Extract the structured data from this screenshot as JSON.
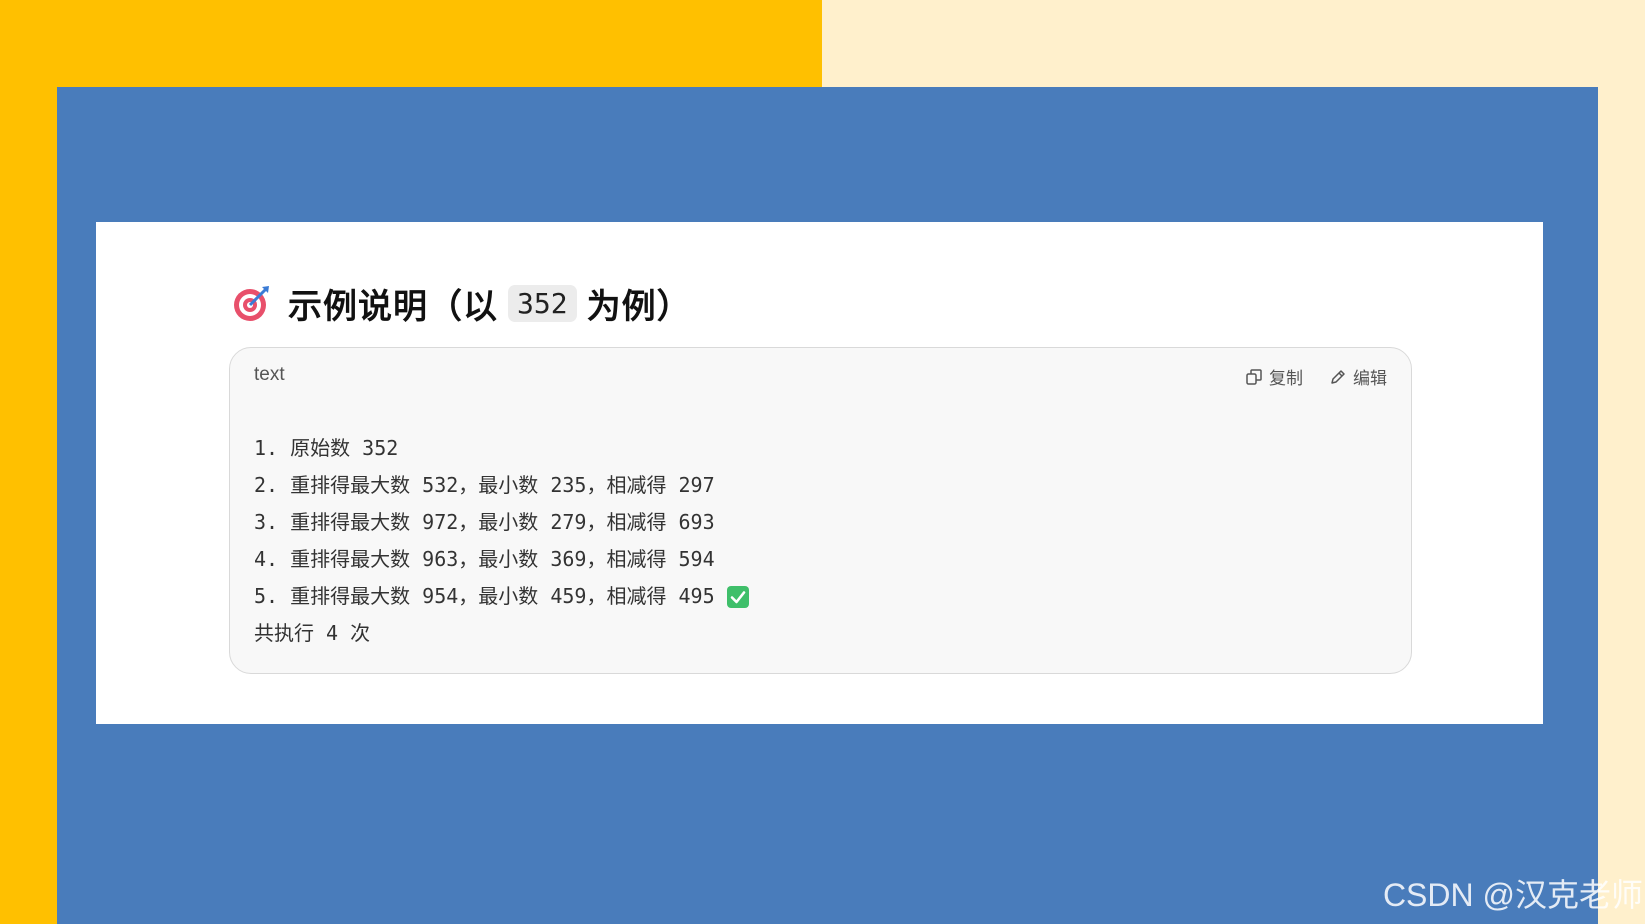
{
  "heading": {
    "icon": "target-icon",
    "text_before": "示例说明（以",
    "code": "352",
    "text_after": "为例）"
  },
  "code_block": {
    "language": "text",
    "copy_label": "复制",
    "edit_label": "编辑",
    "lines": [
      "1. 原始数 352",
      "2. 重排得最大数 532，最小数 235，相减得 297",
      "3. 重排得最大数 972，最小数 279，相减得 693",
      "4. 重排得最大数 963，最小数 369，相减得 594",
      "5. 重排得最大数 954，最小数 459，相减得 495",
      "共执行 4 次"
    ],
    "check_icon": "check-mark-icon"
  },
  "watermark": "CSDN @汉克老师",
  "colors": {
    "gold": "#ffc000",
    "cream": "#fff0cc",
    "blue": "#497cbb",
    "check_green": "#3fbf6a"
  }
}
